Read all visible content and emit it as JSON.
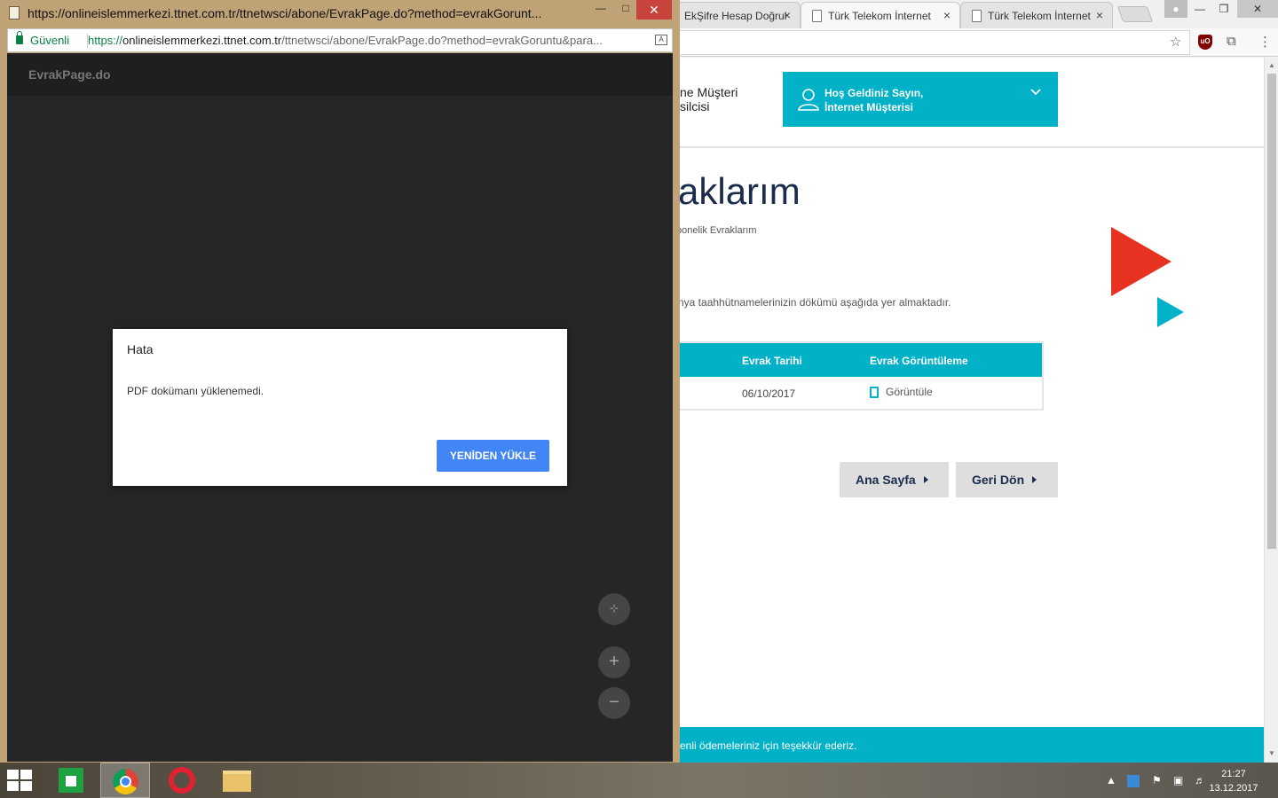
{
  "main_window": {
    "tabs": [
      {
        "label": "EkŞifre Hesap Doğrul",
        "active": false
      },
      {
        "label": "Türk Telekom İnternet",
        "active": true
      },
      {
        "label": "Türk Telekom İnternet",
        "active": false
      }
    ],
    "close_symbol": "×",
    "toolbar_icons": [
      "star-icon",
      "ublock-icon",
      "extension-icon",
      "menu-icon"
    ],
    "header": {
      "agent_line1": "ne Müşteri",
      "agent_line2": "silcisi",
      "welcome_line1": "Hoş Geldiniz Sayın,",
      "welcome_line2": "İnternet Müşterisi",
      "accent_color": "#00b1c8"
    },
    "page_title": "aklarım",
    "breadcrumb": "bonelik Evraklarım",
    "description": "nya taahhütnamelerinizin dökümü aşağıda yer almaktadır.",
    "table": {
      "headers": [
        "Evrak Tarihi",
        "Evrak Görüntüleme"
      ],
      "rows": [
        {
          "date": "06/10/2017",
          "action": "Görüntüle"
        }
      ]
    },
    "buttons": {
      "home": "Ana Sayfa",
      "back": "Geri Dön"
    },
    "footer_text": "enli ödemeleriniz için teşekkür ederiz."
  },
  "popup": {
    "title": "https://onlineislemmerkezi.ttnet.com.tr/ttnetwsci/abone/EvrakPage.do?method=evrakGorunt...",
    "secure_label": "Güvenli",
    "url_proto": "https://",
    "url_host": "onlineislemmerkezi.ttnet.com.tr",
    "url_path": "/ttnetwsci/abone/EvrakPage.do?method=evrakGoruntu&para...",
    "pdf_title": "EvrakPage.do",
    "dialog": {
      "title": "Hata",
      "message": "PDF dokümanı yüklenemedi.",
      "reload_label": "YENİDEN YÜKLE"
    },
    "zoom_in": "+",
    "zoom_out": "−",
    "fit": "⊹"
  },
  "taskbar": {
    "apps": [
      "store-icon",
      "chrome-icon",
      "opera-icon",
      "file-explorer-icon"
    ],
    "time": "21:27",
    "date": "13.12.2017"
  }
}
